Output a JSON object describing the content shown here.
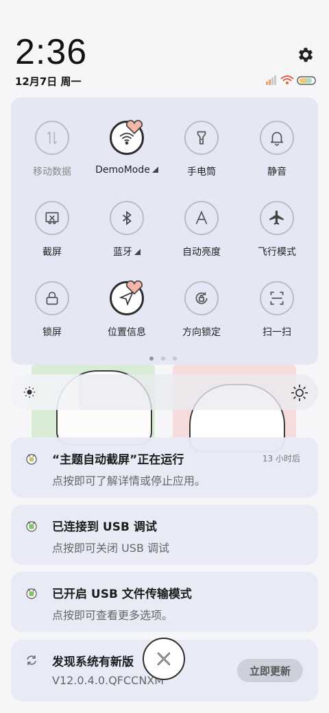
{
  "status": {
    "time": "2:36",
    "date": "12月7日 周一"
  },
  "quick_settings": {
    "tiles": [
      {
        "label": "移动数据",
        "icon": "mobile-data-icon",
        "active": false
      },
      {
        "label": "DemoMode",
        "icon": "wifi-icon",
        "active": true
      },
      {
        "label": "手电筒",
        "icon": "flashlight-icon",
        "active": false
      },
      {
        "label": "静音",
        "icon": "bell-icon",
        "active": false
      },
      {
        "label": "截屏",
        "icon": "screenshot-icon",
        "active": false
      },
      {
        "label": "蓝牙",
        "icon": "bluetooth-icon",
        "active": false
      },
      {
        "label": "自动亮度",
        "icon": "auto-brightness-icon",
        "active": false
      },
      {
        "label": "飞行模式",
        "icon": "airplane-icon",
        "active": false
      },
      {
        "label": "锁屏",
        "icon": "lock-icon",
        "active": false
      },
      {
        "label": "位置信息",
        "icon": "location-icon",
        "active": true
      },
      {
        "label": "方向锁定",
        "icon": "rotation-lock-icon",
        "active": false
      },
      {
        "label": "扫一扫",
        "icon": "scan-icon",
        "active": false
      }
    ],
    "page_count": 3,
    "current_page": 1
  },
  "brightness": {
    "level": 0.22
  },
  "notifications": [
    {
      "title": "“主题自动截屏”正在运行",
      "body": "点按即可了解详情或停止应用。",
      "time": "13 小时后"
    },
    {
      "title": "已连接到 USB 调试",
      "body": "点按即可关闭 USB 调试"
    },
    {
      "title": "已开启 USB 文件传输模式",
      "body": "点按即可查看更多选项。"
    },
    {
      "title": "发现系统有新版",
      "body": "V12.0.4.0.QFCCNXM",
      "action": "立即更新"
    }
  ],
  "colors": {
    "panel": "#e5e8f4",
    "accent_icon": "#7cc36a"
  }
}
